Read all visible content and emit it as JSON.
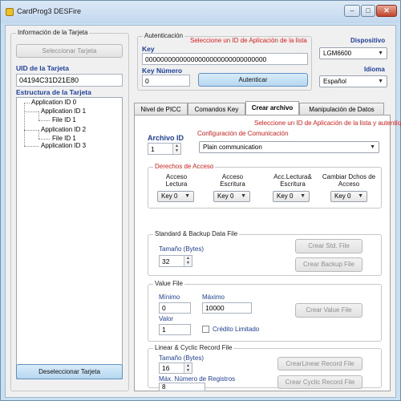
{
  "window": {
    "title": "CardProg3 DESFire",
    "minimize": "–",
    "maximize": "□",
    "close": "✕"
  },
  "left": {
    "group_title": "Información de la Tarjeta",
    "select_button": "Seleccionar Tarjeta",
    "uid_label": "UID de la Tarjeta",
    "uid_value": "04194C31D21E80",
    "structure_label": "Estructura de la Tarjeta",
    "tree": [
      "Application ID 0",
      "Application ID 1",
      "File ID 1",
      "Application ID 2",
      "File ID 1",
      "Application ID 3"
    ],
    "deselect_button": "Deseleccionar Tarjeta"
  },
  "auth": {
    "group_title": "Autenticación",
    "hint": "Seleccione un ID de Aplicación de la lista",
    "key_label": "Key",
    "key_value": "00000000000000000000000000000000",
    "key_number_label": "Key Número",
    "key_number_value": "0",
    "authenticate_button": "Autenticar"
  },
  "device": {
    "label": "Dispositivo",
    "value": "LGM6600",
    "language_label": "Idioma",
    "language_value": "Español"
  },
  "tabs": [
    "Nivel de PICC",
    "Comandos Key",
    "Crear archivo",
    "Manipulación de Datos"
  ],
  "active_tab": "Crear archivo",
  "create": {
    "hint": "Seleccione un ID de Aplicación de la lista y autentíquese",
    "file_id_label": "Archivo ID",
    "file_id_value": "1",
    "comm_label": "Configuración de Comunicación",
    "comm_value": "Plain communication",
    "access_title": "Derechos de Acceso",
    "access_cols": [
      {
        "label": "Acceso Lectura",
        "value": "Key 0"
      },
      {
        "label": "Acceso Escritura",
        "value": "Key 0"
      },
      {
        "label": "Acc.Lectura& Escritura",
        "value": "Key 0"
      },
      {
        "label": "Cambiar Dchos de Acceso",
        "value": "Key 0"
      }
    ],
    "std": {
      "title": "Standard & Backup Data File",
      "size_label": "Tamaño (Bytes)",
      "size_value": "32",
      "create_std": "Crear Std. File",
      "create_backup": "Crear Backup File"
    },
    "value": {
      "title": "Value File",
      "min_label": "Mínimo",
      "min_value": "0",
      "max_label": "Máximo",
      "max_value": "10000",
      "value_label": "Valor",
      "value_value": "1",
      "limited_credit": "Crédito Limitado",
      "create_value": "Crear Value File"
    },
    "record": {
      "title": "Linear & Cyclic Record File",
      "size_label": "Tamaño (Bytes)",
      "size_value": "16",
      "max_label": "Máx. Número de Registros",
      "max_value": "8",
      "create_linear": "CrearLinear Record File",
      "create_cyclic": "Crear Cyclic Record File"
    }
  }
}
